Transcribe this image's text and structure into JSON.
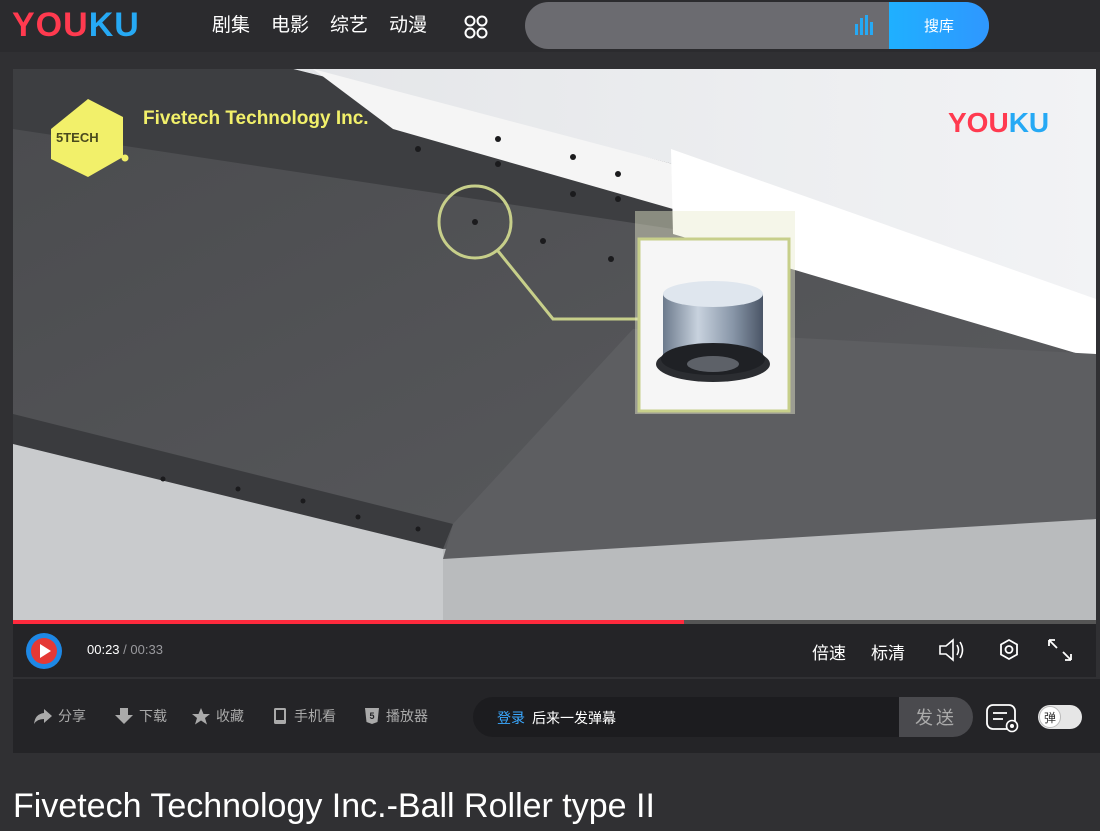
{
  "header": {
    "logo": {
      "part1": "YOU",
      "part2": "KU"
    },
    "nav": [
      "剧集",
      "电影",
      "综艺",
      "动漫"
    ],
    "search": {
      "placeholder": "",
      "button_label": "搜库"
    }
  },
  "video": {
    "company_name": "Fivetech Technology Inc.",
    "company_logo": "5TECH",
    "watermark": {
      "part1": "YOU",
      "part2": "KU"
    }
  },
  "player": {
    "progress": 0.62,
    "current_time": "00:23",
    "separator": "/",
    "duration": "00:33",
    "speed_label": "倍速",
    "quality_label": "标清"
  },
  "actions": {
    "share": "分享",
    "download": "下载",
    "favorite": "收藏",
    "mobile": "手机看",
    "player_app": "播放器"
  },
  "danmu": {
    "login_label": "登录",
    "hint": "后来一发弹幕",
    "send_label": "发送",
    "toggle_label": "弹"
  },
  "page": {
    "title": "Fivetech Technology Inc.-Ball Roller type II"
  },
  "colors": {
    "accent_blue": "#26a9f4",
    "brand_red": "#ff3a4f",
    "progress_red": "#ff2a3d"
  }
}
